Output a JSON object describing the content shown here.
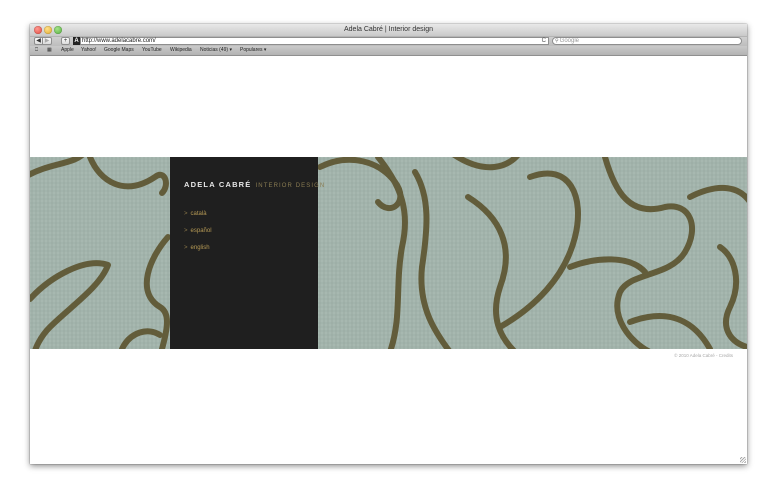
{
  "window": {
    "title": "Adela Cabré | Interior design"
  },
  "toolbar": {
    "back_glyph": "◀",
    "forward_glyph": "▶",
    "add_glyph": "+",
    "site_icon_glyph": "A",
    "url": "http://www.adelacabre.com/",
    "reload_glyph": "C",
    "search_placeholder": "Google"
  },
  "bookmarks": {
    "items": [
      {
        "label": "Apple"
      },
      {
        "label": "Yahoo!"
      },
      {
        "label": "Google Maps"
      },
      {
        "label": "YouTube"
      },
      {
        "label": "Wikipedia"
      },
      {
        "label": "Noticias (49) ▾"
      },
      {
        "label": "Populares ▾"
      }
    ]
  },
  "site": {
    "brand_name": "ADELA CABRÉ",
    "brand_tagline": "INTERIOR DESIGN",
    "languages": [
      {
        "label": "català"
      },
      {
        "label": "español"
      },
      {
        "label": "english"
      }
    ],
    "language_marker": ">",
    "copyright": "© 2010 Adela Cabré - Credits"
  },
  "colors": {
    "panel_background": "#1f1f1f",
    "brand_name": "#e6e6e6",
    "brand_tagline": "#8a7c52",
    "language_link": "#b69a55",
    "hero_fabric": "#9fb0a8",
    "hero_stroke": "#5e5632"
  }
}
